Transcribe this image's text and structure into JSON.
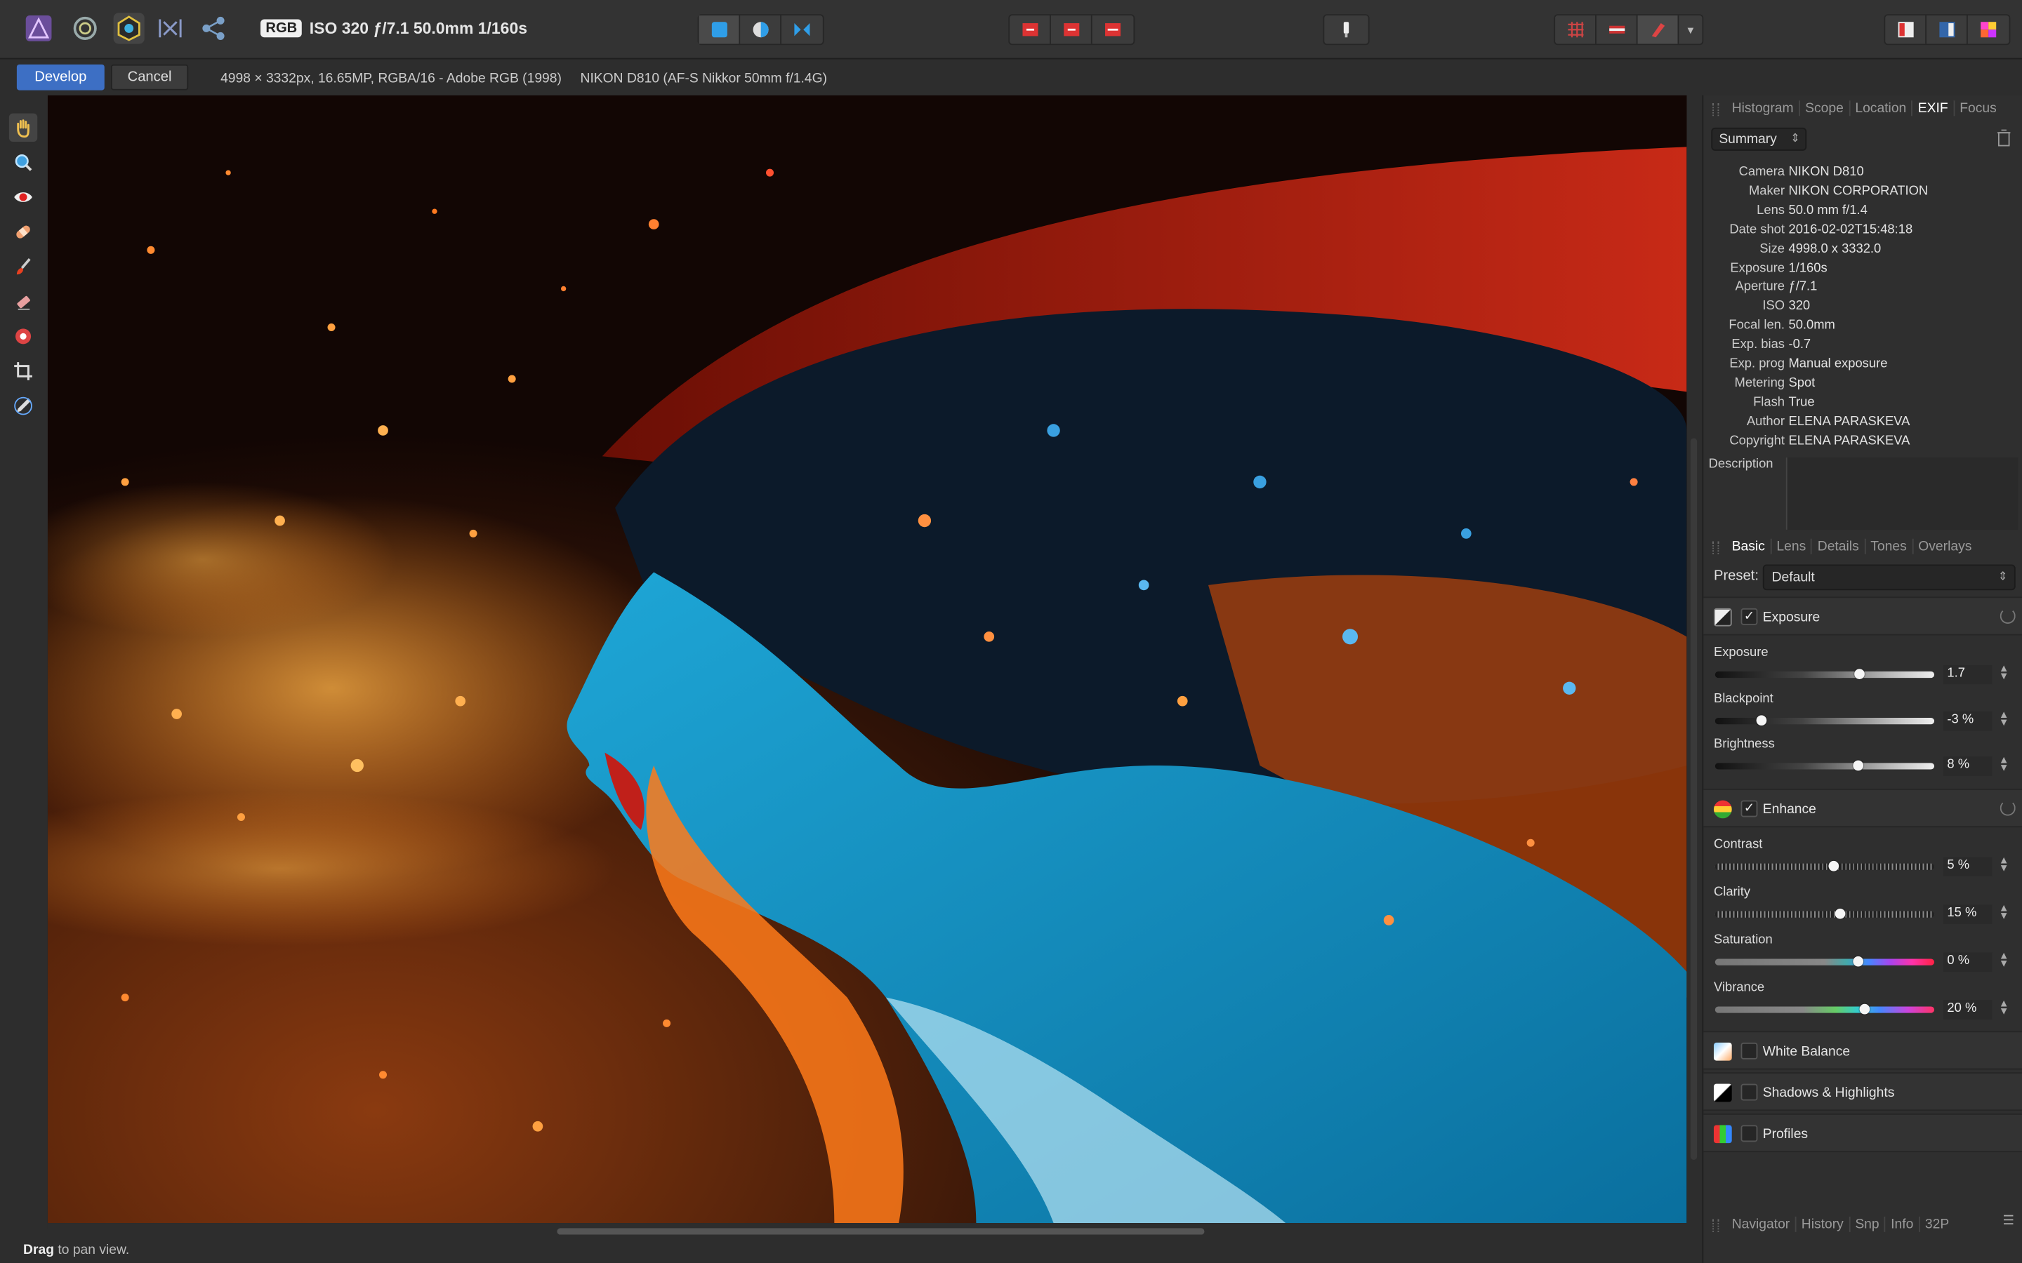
{
  "topbar": {
    "color_mode": "RGB",
    "shot_info": "ISO 320 ƒ/7.1 50.0mm 1/160s"
  },
  "context": {
    "develop_label": "Develop",
    "cancel_label": "Cancel",
    "image_info": "4998 × 3332px, 16.65MP, RGBA/16 - Adobe RGB (1998)",
    "camera_info": "NIKON D810 (AF-S Nikkor 50mm f/1.4G)"
  },
  "status": {
    "action": "Drag",
    "hint": "to pan view."
  },
  "panel_top": {
    "tabs": [
      "Histogram",
      "Scope",
      "Location",
      "EXIF",
      "Focus"
    ],
    "selected_tab": "EXIF",
    "summary_select": "Summary",
    "exif": [
      {
        "k": "Camera",
        "v": "NIKON D810"
      },
      {
        "k": "Maker",
        "v": "NIKON CORPORATION"
      },
      {
        "k": "Lens",
        "v": "50.0 mm f/1.4"
      },
      {
        "k": "Date shot",
        "v": "2016-02-02T15:48:18"
      },
      {
        "k": "Size",
        "v": "4998.0 x 3332.0"
      },
      {
        "k": "Exposure",
        "v": "1/160s"
      },
      {
        "k": "Aperture",
        "v": "ƒ/7.1"
      },
      {
        "k": "ISO",
        "v": "320"
      },
      {
        "k": "Focal len.",
        "v": "50.0mm"
      },
      {
        "k": "Exp. bias",
        "v": "-0.7"
      },
      {
        "k": "Exp. prog",
        "v": "Manual exposure"
      },
      {
        "k": "Metering",
        "v": "Spot"
      },
      {
        "k": "Flash",
        "v": "True"
      },
      {
        "k": "Author",
        "v": "ELENA PARASKEVA"
      },
      {
        "k": "Copyright",
        "v": "ELENA PARASKEVA"
      }
    ],
    "description_label": "Description"
  },
  "panel_mid": {
    "tabs": [
      "Basic",
      "Lens",
      "Details",
      "Tones",
      "Overlays"
    ],
    "selected_tab": "Basic",
    "preset_label": "Preset:",
    "preset_value": "Default",
    "sections": {
      "exposure": {
        "title": "Exposure",
        "checked": "✓"
      },
      "enhance": {
        "title": "Enhance",
        "checked": "✓"
      },
      "white_balance": {
        "title": "White Balance"
      },
      "shadows_highlights": {
        "title": "Shadows & Highlights"
      },
      "profiles": {
        "title": "Profiles"
      }
    },
    "sliders": {
      "exposure": {
        "label": "Exposure",
        "value": "1.7",
        "pos": 0.66
      },
      "blackpoint": {
        "label": "Blackpoint",
        "value": "-3 %",
        "pos": 0.21
      },
      "brightness": {
        "label": "Brightness",
        "value": "8 %",
        "pos": 0.65
      },
      "contrast": {
        "label": "Contrast",
        "value": "5 %",
        "pos": 0.54
      },
      "clarity": {
        "label": "Clarity",
        "value": "15 %",
        "pos": 0.57
      },
      "saturation": {
        "label": "Saturation",
        "value": "0 %",
        "pos": 0.65
      },
      "vibrance": {
        "label": "Vibrance",
        "value": "20 %",
        "pos": 0.68
      }
    }
  },
  "panel_bottom": {
    "tabs": [
      "Navigator",
      "History",
      "Snp",
      "Info",
      "32P"
    ]
  },
  "colors": {
    "accent": "#3d6fc4",
    "panel": "#2f2f2f",
    "toolbar": "#333333"
  }
}
